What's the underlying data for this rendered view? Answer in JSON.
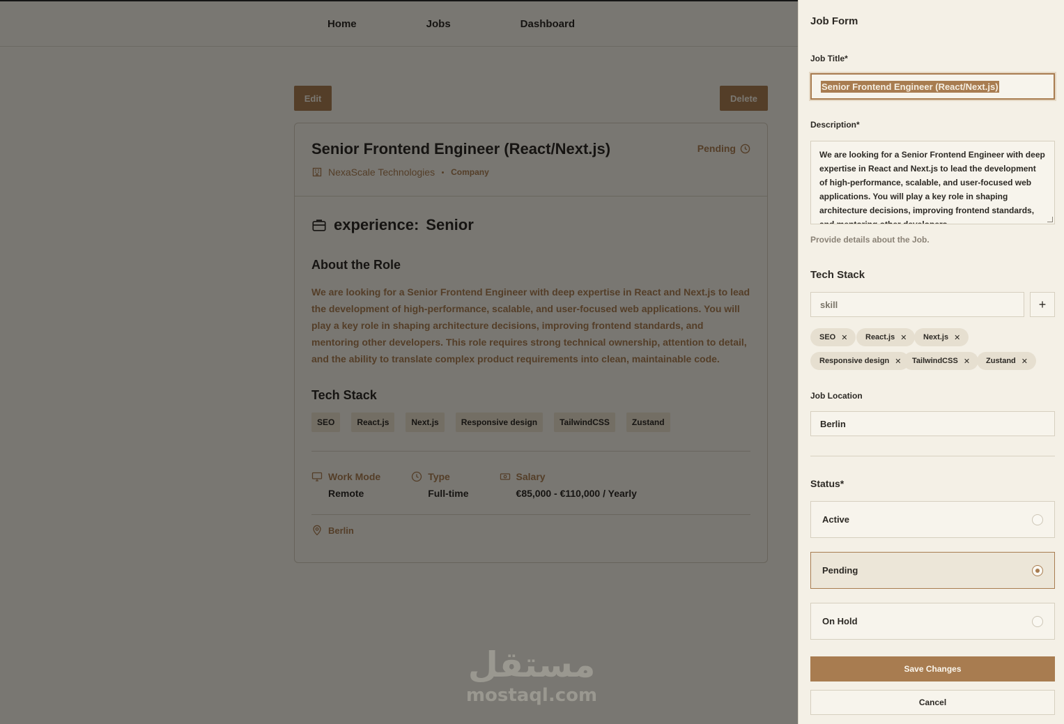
{
  "nav": {
    "home": "Home",
    "jobs": "Jobs",
    "dashboard": "Dashboard"
  },
  "actions": {
    "edit": "Edit",
    "delete": "Delete"
  },
  "job": {
    "title": "Senior Frontend Engineer (React/Next.js)",
    "status": "Pending",
    "company": "NexaScale Technologies",
    "company_tag": "Company",
    "experience_label": "experience:",
    "experience_value": "Senior",
    "about_title": "About the Role",
    "about_text": "We are looking for a Senior Frontend Engineer with deep expertise in React and Next.js to lead the development of high-performance, scalable, and user-focused web applications. You will play a key role in shaping architecture decisions, improving frontend standards, and mentoring other developers. This role requires strong technical ownership, attention to detail, and the ability to translate complex product requirements into clean, maintainable code.",
    "tech_title": "Tech Stack",
    "tech": [
      "SEO",
      "React.js",
      "Next.js",
      "Responsive design",
      "TailwindCSS",
      "Zustand"
    ],
    "work_mode_label": "Work Mode",
    "work_mode": "Remote",
    "type_label": "Type",
    "type": "Full-time",
    "salary_label": "Salary",
    "salary": "€85,000 - €110,000 / Yearly",
    "location": "Berlin"
  },
  "watermark": {
    "arabic": "مستقل",
    "latin": "mostaql.com"
  },
  "form": {
    "title": "Job Form",
    "job_title_label": "Job Title*",
    "job_title_value": "Senior Frontend Engineer (React/Next.js)",
    "description_label": "Description*",
    "description_value": "We are looking for a Senior Frontend Engineer with deep expertise in React and Next.js to lead the development of high-performance, scalable, and user-focused web applications. You will play a key role in shaping architecture decisions, improving frontend standards, and mentoring other developers.",
    "description_hint": "Provide details about the Job.",
    "tech_label": "Tech Stack",
    "skill_placeholder": "skill",
    "add_label": "+",
    "tags": [
      "SEO",
      "React.js",
      "Next.js",
      "Responsive design",
      "TailwindCSS",
      "Zustand"
    ],
    "location_label": "Job Location",
    "location_value": "Berlin",
    "status_label": "Status*",
    "status_options": [
      "Active",
      "Pending",
      "On Hold"
    ],
    "status_selected": "Pending",
    "save_label": "Save Changes",
    "cancel_label": "Cancel"
  },
  "colors": {
    "accent": "#a87c50",
    "panel_bg": "#f4f0e6"
  }
}
